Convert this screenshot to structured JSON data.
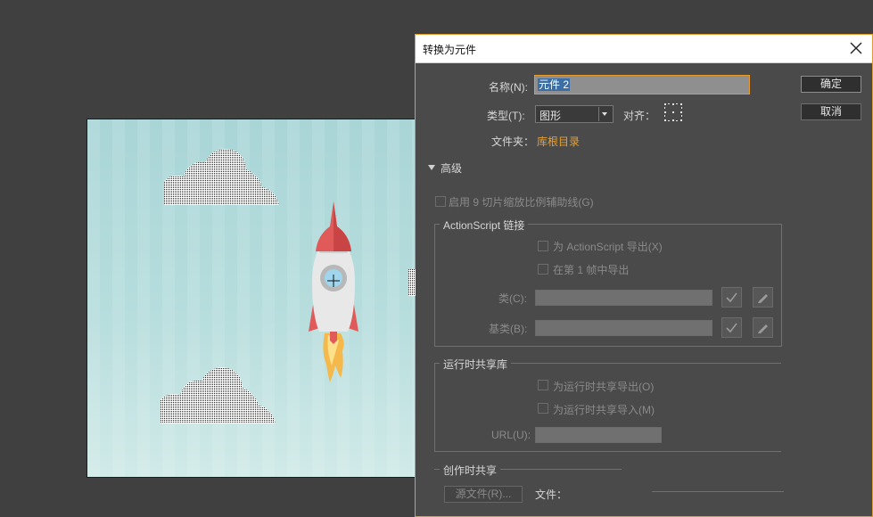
{
  "dialog": {
    "title": "转换为元件",
    "name_label": "名称(N):",
    "name_value": "元件 2",
    "type_label": "类型(T):",
    "type_value": "图形",
    "align_label": "对齐：",
    "folder_label": "文件夹：",
    "folder_value": "库根目录",
    "ok_label": "确定",
    "cancel_label": "取消",
    "advanced_label": "高级",
    "slice_label": "启用 9 切片缩放比例辅助线(G)",
    "actionscript": {
      "group_title": "ActionScript 链接",
      "export_as_label": "为 ActionScript 导出(X)",
      "export_frame1_label": "在第 1 帧中导出",
      "class_label": "类(C):",
      "base_class_label": "基类(B):"
    },
    "runtime_share": {
      "group_title": "运行时共享库",
      "export_label": "为运行时共享导出(O)",
      "import_label": "为运行时共享导入(M)",
      "url_label": "URL(U):"
    },
    "authortime_share": {
      "group_title": "创作时共享",
      "source_button": "源文件(R)...",
      "file_label": "文件："
    }
  },
  "colors": {
    "accent": "#e59a2b",
    "folder_link": "#e8a030",
    "selection": "#3a6ea5",
    "workspace": "#404040",
    "dialog_bg": "#4a4a4a"
  },
  "icons": [
    "close-icon",
    "dropdown-arrow-icon",
    "registration-grid-icon",
    "disclosure-triangle-icon",
    "checkmark-icon",
    "pencil-icon",
    "crosshair-icon"
  ]
}
